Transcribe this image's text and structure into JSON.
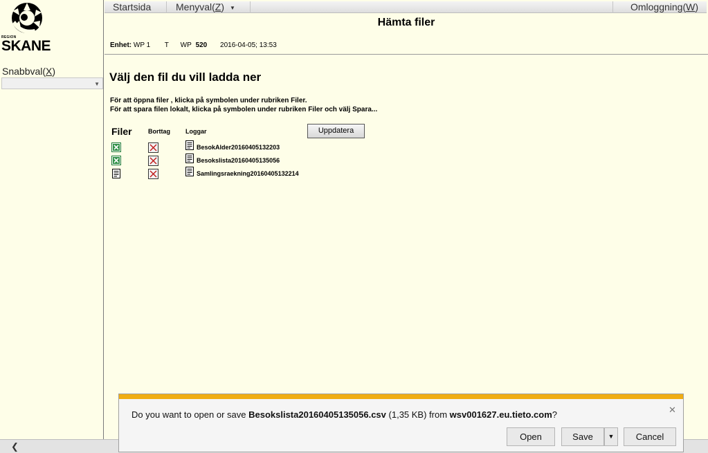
{
  "sidebar": {
    "logo": {
      "region": "REGION",
      "name": "SKANE"
    },
    "snabbval_label": "Snabbval(",
    "snabbval_key": "X",
    "snabbval_close": ")",
    "snabbval_value": ""
  },
  "menubar": {
    "startsida": "Startsida",
    "menyval": "Menyval(",
    "menyval_key": "Z",
    "menyval_close": ")",
    "omloggning": "Omloggning(",
    "omloggning_key": "W",
    "omloggning_close": ")"
  },
  "page": {
    "title": "Hämta filer",
    "enhet_label": "Enhet:",
    "enhet_value": "WP 1",
    "t_label": "T",
    "wp_label": "WP",
    "wp_value": "520",
    "datetime": "2016-04-05; 13:53",
    "heading": "Välj den fil du vill ladda ner",
    "instruction1": "För att öppna filer , klicka på symbolen under rubriken Filer.",
    "instruction2": "För att spara filen lokalt, klicka på symbolen under rubriken Filer och välj Spara...",
    "col_filer": "Filer",
    "col_borttag": "Borttag",
    "col_loggar": "Loggar",
    "update_button": "Uppdatera",
    "files": [
      {
        "type": "excel",
        "log": "BesokAlder20160405132203"
      },
      {
        "type": "excel",
        "log": "Besokslista20160405135056"
      },
      {
        "type": "document",
        "log": "Samlingsraekning20160405132214"
      }
    ]
  },
  "notification": {
    "prefix": "Do you want to open or save ",
    "filename": "Besokslista20160405135056.csv",
    "size": " (1,35 KB) from ",
    "host": "wsv001627.eu.tieto.com",
    "suffix": "?",
    "open": "Open",
    "save": "Save",
    "cancel": "Cancel",
    "accent_color": "#f0ad12"
  },
  "icons": {
    "excel": "excel-file-icon",
    "document": "document-file-icon",
    "delete": "delete-x-icon"
  }
}
